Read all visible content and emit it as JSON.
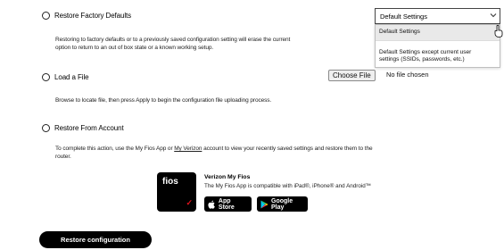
{
  "options": {
    "factory": {
      "label": "Restore Factory Defaults",
      "description_line1": "Restoring to factory defaults or to a previously saved configuration setting will erase the current",
      "description_line2": "option to return to an out of box state or a known working setup."
    },
    "load_file": {
      "label": "Load a File",
      "description": "Browse to locate file, then press Apply to begin the configuration file uploading process.",
      "choose_file_label": "Choose File",
      "no_file_text": "No file chosen"
    },
    "account": {
      "label": "Restore From Account",
      "description_pre": "To complete this action, use the My Fios App or ",
      "link_text": "My Verizon",
      "description_post": " account to view your recently saved settings and restore them to the",
      "description_line2": "router."
    }
  },
  "settings_select": {
    "selected": "Default Settings",
    "options": [
      "Default Settings",
      "Default Settings except current user",
      "settings (SSIDs, passwords, etc.)"
    ]
  },
  "promo": {
    "logo_text": "fios",
    "title": "Verizon My Fios",
    "description": "The My Fios App is compatible with iPad®, iPhone® and Android™",
    "app_store_label": "App Store",
    "google_play_label": "Google Play"
  },
  "restore_button_label": "Restore configuration",
  "colors": {
    "brand_red": "#e0121c",
    "button_black": "#000000"
  },
  "icons": {
    "dropdown": "chevron-down-icon",
    "apple": "apple-icon",
    "play": "google-play-icon",
    "cursor": "mouse-cursor-icon"
  }
}
